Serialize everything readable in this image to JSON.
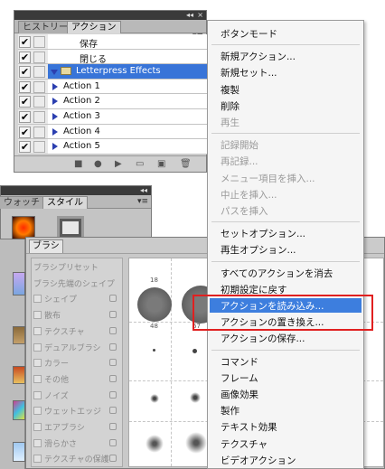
{
  "actions_panel": {
    "tabs": [
      "ヒストリー",
      "アクション"
    ],
    "window_controls": "◂◂ ×",
    "menu_glyph": "▾≡",
    "rows": [
      {
        "label": "保存",
        "checked": true,
        "indent": 2
      },
      {
        "label": "閉じる",
        "checked": true,
        "indent": 2
      },
      {
        "label": "Letterpress Effects",
        "checked": true,
        "selected": true,
        "type": "set"
      },
      {
        "label": "Action 1",
        "checked": true,
        "type": "action"
      },
      {
        "label": "Action 2",
        "checked": true,
        "type": "action"
      },
      {
        "label": "Action 3",
        "checked": true,
        "type": "action"
      },
      {
        "label": "Action 4",
        "checked": true,
        "type": "action"
      },
      {
        "label": "Action 5",
        "checked": true,
        "type": "action"
      }
    ],
    "bottom_buttons": [
      "■",
      "●",
      "▶",
      "▭",
      "▣",
      "🗑"
    ]
  },
  "style_panel": {
    "tabs": [
      "ウォッチ",
      "スタイル"
    ],
    "window_controls": "◂◂",
    "menu_glyph": "▾≡"
  },
  "brush_panel": {
    "tab": "ブラシ",
    "sections": [
      {
        "label": "ブラシプリセット",
        "checkbox": false,
        "lock": false
      },
      {
        "label": "ブラシ先端のシェイプ",
        "checkbox": false,
        "lock": false
      },
      {
        "label": "シェイプ",
        "checkbox": true,
        "lock": true
      },
      {
        "label": "散布",
        "checkbox": true,
        "lock": true
      },
      {
        "label": "テクスチャ",
        "checkbox": true,
        "lock": true
      },
      {
        "label": "デュアルブラシ",
        "checkbox": true,
        "lock": true
      },
      {
        "label": "カラー",
        "checkbox": true,
        "lock": true
      },
      {
        "label": "その他",
        "checkbox": true,
        "lock": true
      },
      {
        "label": "ノイズ",
        "checkbox": true,
        "lock": true
      },
      {
        "label": "ウェットエッジ",
        "checkbox": true,
        "lock": true
      },
      {
        "label": "エアブラシ",
        "checkbox": true,
        "lock": true
      },
      {
        "label": "滑らかさ",
        "checkbox": true,
        "lock": true
      },
      {
        "label": "テクスチャの保護",
        "checkbox": true,
        "lock": true
      }
    ],
    "size_labels": [
      "18",
      "48",
      "67"
    ]
  },
  "context_menu": {
    "items": [
      {
        "label": "ボタンモード",
        "disabled": false
      },
      {
        "sep": true
      },
      {
        "label": "新規アクション...",
        "disabled": false
      },
      {
        "label": "新規セット...",
        "disabled": false
      },
      {
        "label": "複製",
        "disabled": false
      },
      {
        "label": "削除",
        "disabled": false
      },
      {
        "label": "再生",
        "disabled": true
      },
      {
        "sep": true
      },
      {
        "label": "記録開始",
        "disabled": true
      },
      {
        "label": "再記録...",
        "disabled": true
      },
      {
        "label": "メニュー項目を挿入...",
        "disabled": true
      },
      {
        "label": "中止を挿入...",
        "disabled": true
      },
      {
        "label": "パスを挿入",
        "disabled": true
      },
      {
        "sep": true
      },
      {
        "label": "セットオプション...",
        "disabled": false
      },
      {
        "label": "再生オプション...",
        "disabled": false
      },
      {
        "sep": true
      },
      {
        "label": "すべてのアクションを消去",
        "disabled": false
      },
      {
        "label": "初期設定に戻す",
        "disabled": false
      },
      {
        "label": "アクションを読み込み...",
        "disabled": false,
        "highlighted": true
      },
      {
        "label": "アクションの置き換え...",
        "disabled": false
      },
      {
        "label": "アクションの保存...",
        "disabled": false
      },
      {
        "sep": true
      },
      {
        "label": "コマンド",
        "disabled": false
      },
      {
        "label": "フレーム",
        "disabled": false
      },
      {
        "label": "画像効果",
        "disabled": false
      },
      {
        "label": "製作",
        "disabled": false
      },
      {
        "label": "テキスト効果",
        "disabled": false
      },
      {
        "label": "テクスチャ",
        "disabled": false
      },
      {
        "label": "ビデオアクション",
        "disabled": false
      }
    ]
  },
  "colors": {
    "selection": "#3874d8",
    "menu_highlight": "#3d7ede",
    "annotation_box": "#e02020"
  }
}
